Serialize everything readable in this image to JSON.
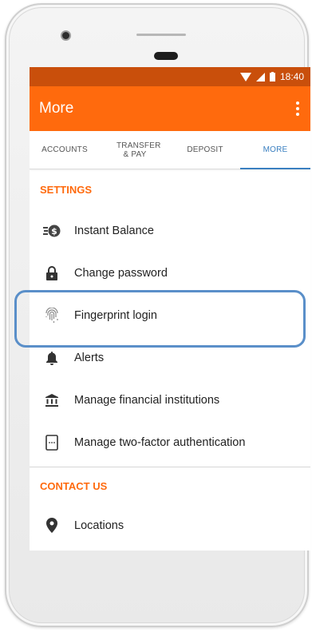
{
  "status_bar": {
    "time": "18:40"
  },
  "app_bar": {
    "title": "More"
  },
  "tabs": [
    {
      "label": "ACCOUNTS"
    },
    {
      "label": "TRANSFER & PAY"
    },
    {
      "label": "DEPOSIT"
    },
    {
      "label": "MORE",
      "active": true
    }
  ],
  "settings": {
    "header": "SETTINGS",
    "items": [
      {
        "label": "Instant Balance",
        "icon": "instant-balance-icon"
      },
      {
        "label": "Change password",
        "icon": "lock-icon"
      },
      {
        "label": "Fingerprint login",
        "icon": "fingerprint-icon"
      },
      {
        "label": "Alerts",
        "icon": "bell-icon"
      },
      {
        "label": "Manage financial institutions",
        "icon": "bank-icon"
      },
      {
        "label": "Manage two-factor authentication",
        "icon": "device-icon"
      }
    ]
  },
  "contact": {
    "header": "CONTACT US",
    "items": [
      {
        "label": "Locations",
        "icon": "location-pin-icon"
      }
    ]
  },
  "colors": {
    "status_bar": "#c94f0b",
    "app_bar": "#ff6a0d",
    "accent_blue": "#3a7fc0",
    "highlight": "#5a8fc9"
  }
}
